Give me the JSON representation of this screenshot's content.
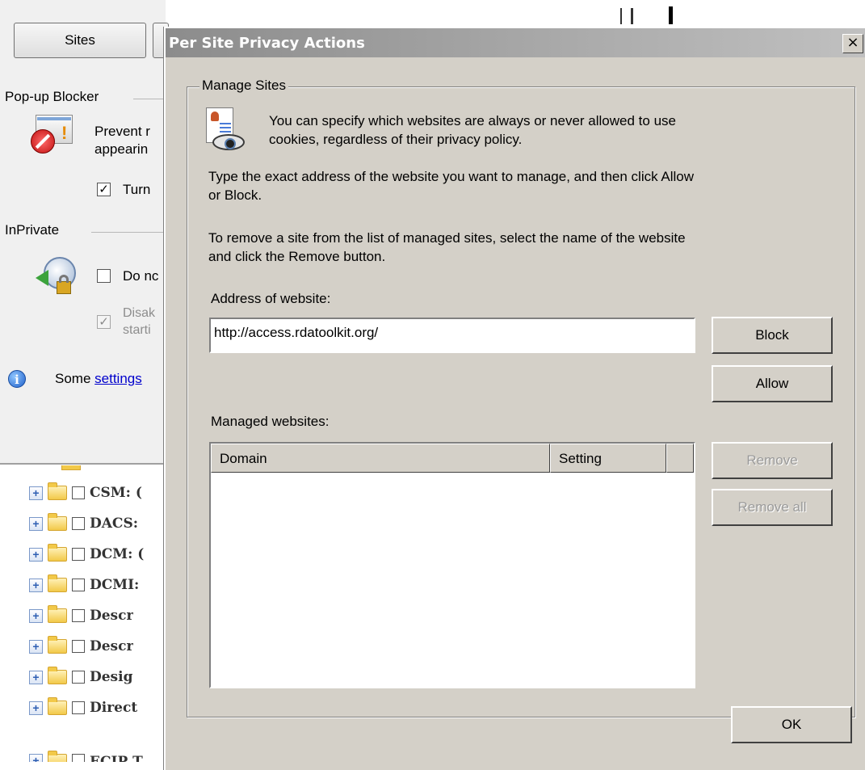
{
  "background": {
    "sites_label": "Sites",
    "popup_group": "Pop-up Blocker",
    "popup_desc_1": "Prevent r",
    "popup_desc_2": "appearin",
    "turn_label": "Turn",
    "inprivate_group": "InPrivate",
    "do_not_label": "Do nc",
    "disable_1": "Disak",
    "disable_2": "starti",
    "some_text": "Some ",
    "settings_link": "settings",
    "tree_items": [
      "CSM: (",
      "DACS:",
      "DCM: (",
      "DCMI:",
      "Descr",
      "Descr",
      "Desig",
      "Direct",
      "ECIP T"
    ]
  },
  "dialog": {
    "title": "Per Site Privacy Actions",
    "close_glyph": "×",
    "group_label": "Manage Sites",
    "intro_1": "You can specify which websites are always or never allowed to use",
    "intro_2": "cookies, regardless of their privacy policy.",
    "instruction_1": "Type the exact address of the website you want to manage, and then click Allow",
    "instruction_2": "or Block.",
    "remove_info_1": "To remove a site from the list of managed sites, select the name of the website",
    "remove_info_2": "and click the Remove button.",
    "address_label": "Address of website:",
    "address_value": "http://access.rdatoolkit.org/",
    "block_label": "Block",
    "allow_label": "Allow",
    "managed_label": "Managed websites:",
    "col_domain": "Domain",
    "col_setting": "Setting",
    "remove_label": "Remove",
    "remove_all_label": "Remove all",
    "ok_label": "OK"
  }
}
